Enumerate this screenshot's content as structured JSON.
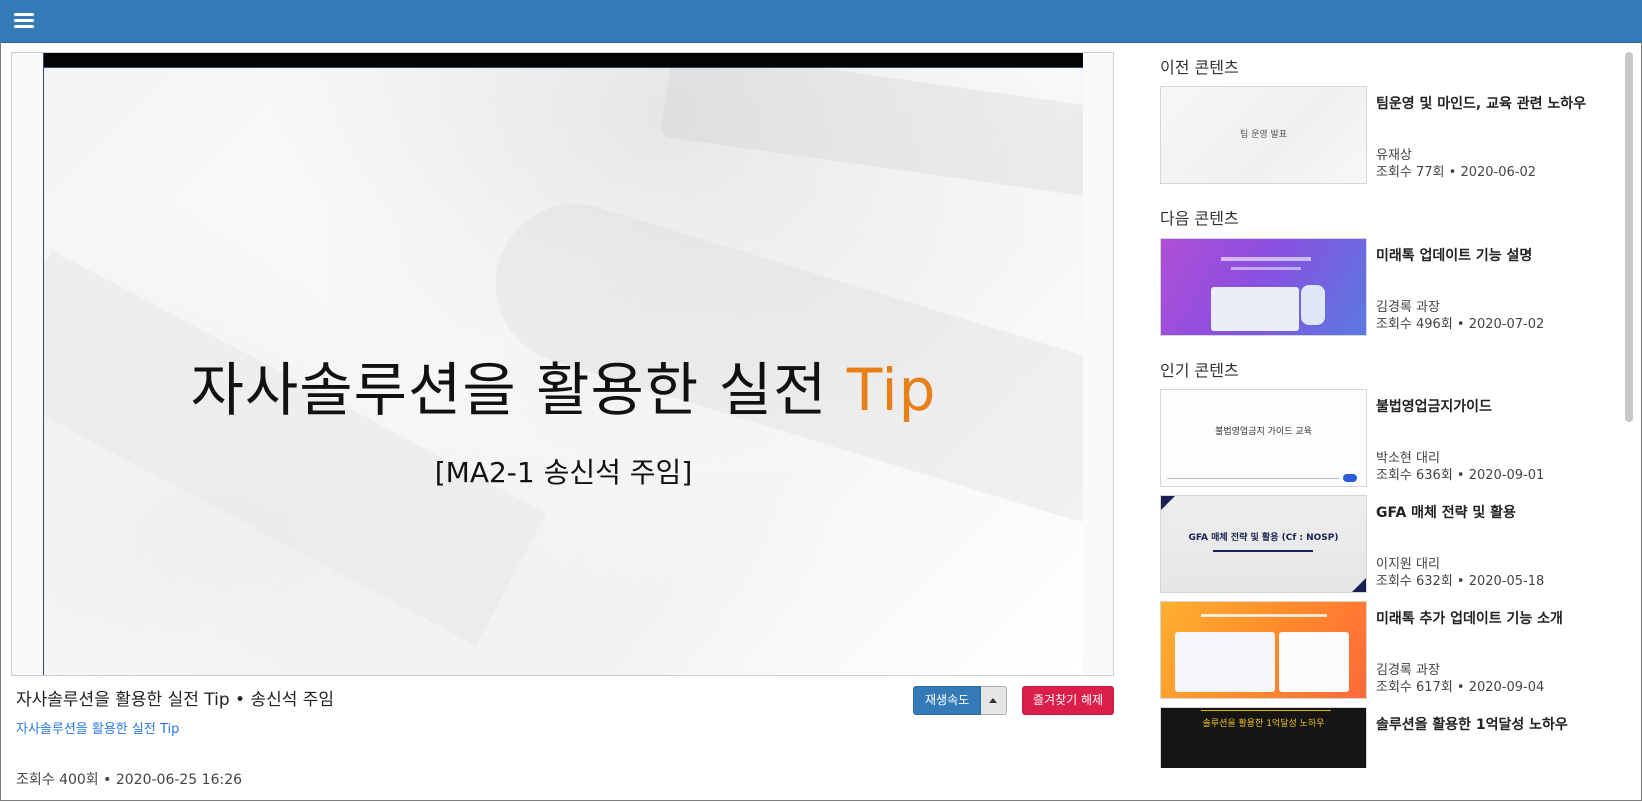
{
  "video": {
    "slide_title_main": "자사솔루션을 활용한 실전 ",
    "slide_title_accent": "Tip",
    "slide_subtitle": "[MA2-1 송신석 주임]",
    "title": "자사솔루션을 활용한 실전 Tip • 송신석 주임",
    "link": "자사솔루션을 활용한 실전 Tip",
    "meta": "조회수 400회 • 2020-06-25 16:26",
    "speed_label": "재생속도",
    "favorite_label": "즐겨찾기 해제"
  },
  "sidebar": {
    "prev_heading": "이전 콘텐츠",
    "next_heading": "다음 콘텐츠",
    "popular_heading": "인기 콘텐츠",
    "prev": {
      "thumb_text": "팀 운영 발표",
      "title": "팀운영 및 마인드, 교육 관련 노하우",
      "author": "유재상",
      "meta": "조회수 77회 • 2020-06-02"
    },
    "next": {
      "title": "미래톡 업데이트 기능 설명",
      "author": "김경록 과장",
      "meta": "조회수 496회 • 2020-07-02"
    },
    "popular": [
      {
        "thumb_text": "불법영업금지 가이드 교육",
        "title": "불법영업금지가이드",
        "author": "박소현 대리",
        "meta": "조회수 636회 • 2020-09-01"
      },
      {
        "thumb_text": "GFA 매체 전략 및 활용 (Cf : NOSP)",
        "title": "GFA 매체 전략 및 활용",
        "author": "이지원 대리",
        "meta": "조회수 632회 • 2020-05-18"
      },
      {
        "title": "미래톡 추가 업데이트 기능 소개",
        "author": "김경록 과장",
        "meta": "조회수 617회 • 2020-09-04"
      },
      {
        "thumb_text": "솔루션을 활용한 1억달성 노하우",
        "title": "솔루션을 활용한 1억달성 노하우"
      }
    ]
  },
  "colors": {
    "topbar": "#337ab7",
    "accent_orange": "#e8801a",
    "favorite_red": "#dc1f4a",
    "link_blue": "#2a7ae2"
  }
}
